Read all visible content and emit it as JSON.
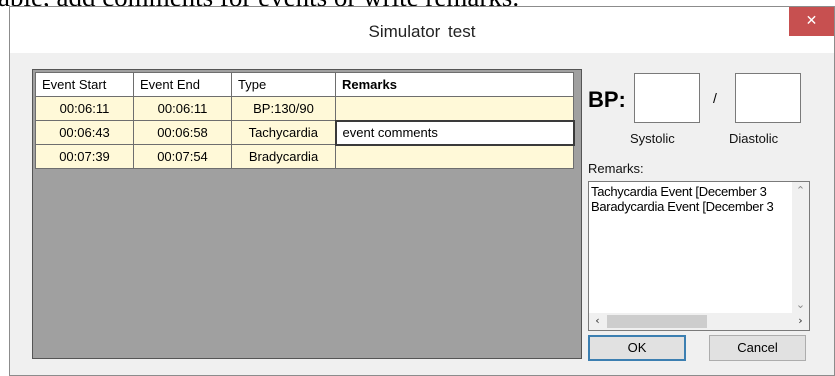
{
  "background_text": "able, add comments for events or write remarks.",
  "window": {
    "title": "Simulator    test",
    "close_glyph": "✕"
  },
  "grid": {
    "columns": [
      "Event Start",
      "Event End",
      "Type",
      "Remarks"
    ],
    "rows": [
      {
        "start": "00:06:11",
        "end": "00:06:11",
        "type": "BP:130/90",
        "remarks": ""
      },
      {
        "start": "00:06:43",
        "end": "00:06:58",
        "type": "Tachycardia",
        "remarks": "event comments"
      },
      {
        "start": "00:07:39",
        "end": "00:07:54",
        "type": "Bradycardia",
        "remarks": ""
      }
    ]
  },
  "bp": {
    "label": "BP:",
    "slash": "/",
    "systolic_label": "Systolic",
    "diastolic_label": "Diastolic",
    "systolic_value": "",
    "diastolic_value": ""
  },
  "remarks": {
    "label": "Remarks:",
    "text": "Tachycardia Event [December 3\nBaradycardia Event [December 3"
  },
  "buttons": {
    "ok": "OK",
    "cancel": "Cancel"
  },
  "colors": {
    "row_fill": "#fff9d8",
    "close_button": "#c75050",
    "grid_background": "#a0a0a0"
  },
  "icons": {
    "close": "close-icon",
    "scroll_up": "chevron-up-icon",
    "scroll_down": "chevron-down-icon",
    "scroll_left": "chevron-left-icon",
    "scroll_right": "chevron-right-icon"
  }
}
